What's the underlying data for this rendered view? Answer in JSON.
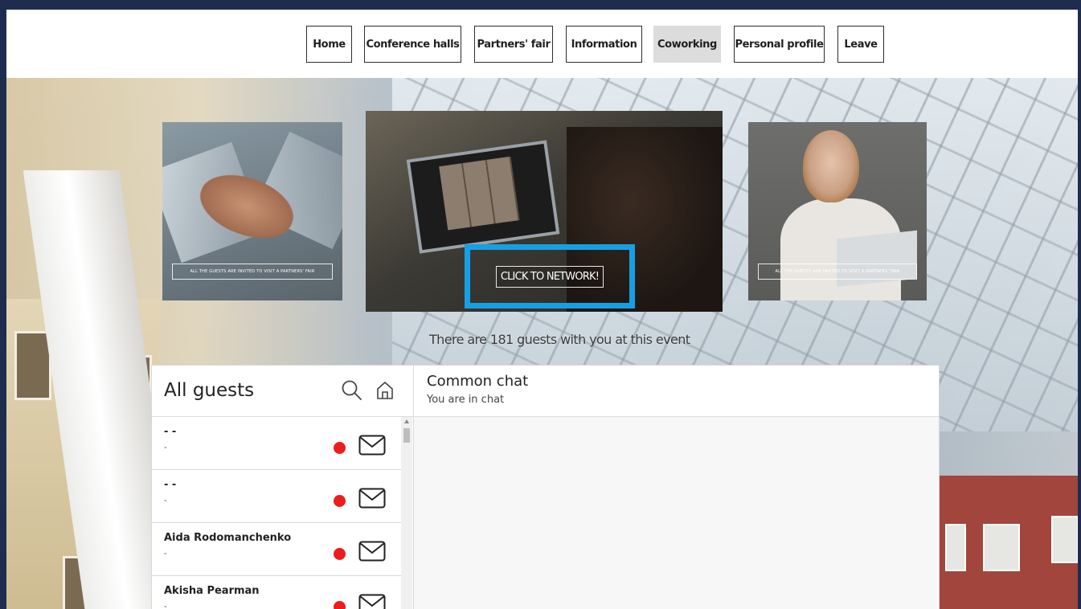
{
  "nav": {
    "items": [
      {
        "label": "Home",
        "active": false
      },
      {
        "label": "Conference halls",
        "active": false
      },
      {
        "label": "Partners' fair",
        "active": false
      },
      {
        "label": "Information",
        "active": false
      },
      {
        "label": "Coworking",
        "active": true
      },
      {
        "label": "Personal profile",
        "active": false
      },
      {
        "label": "Leave",
        "active": false
      }
    ]
  },
  "cards": {
    "left_caption": "ALL THE GUESTS ARE INVITED TO VISIT A PARTNERS' FAIR",
    "center_button": "CLICK TO NETWORK!",
    "right_caption": "ALL THE GUESTS ARE INVITED TO VISIT A PARTNERS' FAIR"
  },
  "event": {
    "guest_count_text": "There are 181 guests with you at this event"
  },
  "guests_panel": {
    "title": "All guests",
    "search_icon": "search-icon",
    "home_icon": "home-icon",
    "guests": [
      {
        "name": "- -",
        "subtitle": "-",
        "status_color": "#ee1c1c"
      },
      {
        "name": "- -",
        "subtitle": "-",
        "status_color": "#ee1c1c"
      },
      {
        "name": "Aida Rodomanchenko",
        "subtitle": "-",
        "status_color": "#ee1c1c"
      },
      {
        "name": "Akisha Pearman",
        "subtitle": "-",
        "status_color": "#ee1c1c"
      }
    ]
  },
  "chat": {
    "title": "Common chat",
    "subtitle": "You are in chat"
  },
  "colors": {
    "highlight": "#16a0e3",
    "status_offline": "#ee1c1c",
    "outer_bg": "#1e2d4f"
  }
}
